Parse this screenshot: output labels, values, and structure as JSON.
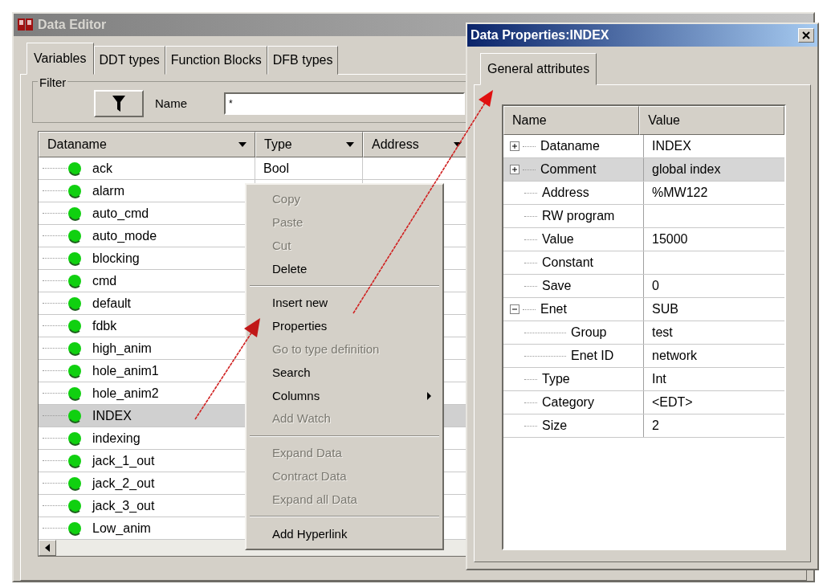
{
  "data_editor": {
    "title": "Data Editor",
    "tabs": [
      {
        "label": "Variables",
        "selected": true
      },
      {
        "label": "DDT types",
        "selected": false
      },
      {
        "label": "Function Blocks",
        "selected": false
      },
      {
        "label": "DFB types",
        "selected": false
      }
    ],
    "filter": {
      "label": "Filter",
      "name_label": "Name",
      "name_value": "*"
    },
    "table": {
      "columns": [
        "Dataname",
        "Type",
        "Address"
      ],
      "rows": [
        {
          "dataname": "ack",
          "type": "Bool",
          "selected": false
        },
        {
          "dataname": "alarm",
          "selected": false
        },
        {
          "dataname": "auto_cmd",
          "selected": false
        },
        {
          "dataname": "auto_mode",
          "selected": false
        },
        {
          "dataname": "blocking",
          "selected": false
        },
        {
          "dataname": "cmd",
          "selected": false
        },
        {
          "dataname": "default",
          "selected": false
        },
        {
          "dataname": "fdbk",
          "selected": false
        },
        {
          "dataname": "high_anim",
          "selected": false
        },
        {
          "dataname": "hole_anim1",
          "selected": false
        },
        {
          "dataname": "hole_anim2",
          "selected": false
        },
        {
          "dataname": "INDEX",
          "selected": true
        },
        {
          "dataname": "indexing",
          "selected": false
        },
        {
          "dataname": "jack_1_out",
          "selected": false
        },
        {
          "dataname": "jack_2_out",
          "selected": false
        },
        {
          "dataname": "jack_3_out",
          "selected": false
        },
        {
          "dataname": "Low_anim",
          "selected": false
        }
      ]
    }
  },
  "context_menu": {
    "items": [
      {
        "kind": "item",
        "label": "Copy",
        "disabled": true
      },
      {
        "kind": "item",
        "label": "Paste",
        "disabled": true
      },
      {
        "kind": "item",
        "label": "Cut",
        "disabled": true
      },
      {
        "kind": "item",
        "label": "Delete",
        "disabled": false
      },
      {
        "kind": "separator"
      },
      {
        "kind": "item",
        "label": "Insert new",
        "disabled": false
      },
      {
        "kind": "item",
        "label": "Properties",
        "disabled": false
      },
      {
        "kind": "item",
        "label": "Go to type definition",
        "disabled": true
      },
      {
        "kind": "item",
        "label": "Search",
        "disabled": false
      },
      {
        "kind": "submenu",
        "label": "Columns",
        "disabled": false
      },
      {
        "kind": "item",
        "label": "Add Watch",
        "disabled": true
      },
      {
        "kind": "separator"
      },
      {
        "kind": "item",
        "label": "Expand Data",
        "disabled": true
      },
      {
        "kind": "item",
        "label": "Contract Data",
        "disabled": true
      },
      {
        "kind": "item",
        "label": "Expand all Data",
        "disabled": true
      },
      {
        "kind": "separator"
      },
      {
        "kind": "item",
        "label": "Add Hyperlink",
        "disabled": false
      }
    ]
  },
  "properties_dialog": {
    "title": "Data Properties:INDEX",
    "tabs": [
      {
        "label": "General attributes",
        "selected": true
      }
    ],
    "table": {
      "columns": [
        "Name",
        "Value"
      ],
      "rows": [
        {
          "name": "Dataname",
          "value": "INDEX",
          "expanded": false,
          "selected": false
        },
        {
          "name": "Comment",
          "value": "global index",
          "expanded": false,
          "selected": true
        },
        {
          "name": "Address",
          "value": "%MW122",
          "selected": false
        },
        {
          "name": "RW program",
          "selected": false
        },
        {
          "name": "Value",
          "value": "15000",
          "selected": false
        },
        {
          "name": "Constant",
          "selected": false
        },
        {
          "name": "Save",
          "value": "0",
          "selected": false
        },
        {
          "name": "Enet",
          "value": "SUB",
          "expanded": true,
          "selected": false,
          "children": [
            {
              "name": "Group",
              "value": "test",
              "selected": false
            },
            {
              "name": "Enet ID",
              "value": "network",
              "selected": false
            }
          ]
        },
        {
          "name": "Type",
          "value": "Int",
          "selected": false
        },
        {
          "name": "Category",
          "value": "<EDT>",
          "selected": false
        },
        {
          "name": "Size",
          "value": "2",
          "selected": false
        }
      ]
    }
  }
}
